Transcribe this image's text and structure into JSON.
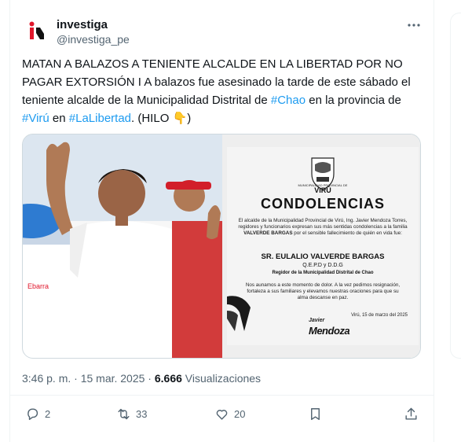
{
  "tweet": {
    "author_name": "investiga",
    "author_handle": "@investiga_pe",
    "text_parts": [
      {
        "t": "MATAN A BALAZOS A TENIENTE ALCALDE EN LA LIBERTAD POR NO PAGAR EXTORSIÓN I A balazos fue asesinado la tarde de este sábado el teniente alcalde de la Municipalidad Distrital de ",
        "tag": false
      },
      {
        "t": "#Chao",
        "tag": true
      },
      {
        "t": " en la provincia de ",
        "tag": false
      },
      {
        "t": "#Virú",
        "tag": true
      },
      {
        "t": " en ",
        "tag": false
      },
      {
        "t": "#LaLibertad",
        "tag": true
      },
      {
        "t": ". (HILO 👇)",
        "tag": false
      }
    ],
    "timestamp": "3:46 p. m. · 15 mar. 2025 · ",
    "views_count": "6.666",
    "views_label": " Visualizaciones",
    "replies": "2",
    "reposts": "33",
    "likes": "20"
  },
  "card": {
    "logo_line1": "MUNICIPALIDAD PROVINCIAL DE",
    "logo_line2": "VIRÚ",
    "title": "CONDOLENCIAS",
    "text1_a": "El alcalde de la Municipalidad Provincial de Virú, Ing. Javier Mendoza Torres, regidores y funcionarios expresan sus más sentidas condolencias a la familia ",
    "text1_b": "VALVERDE BARGAS",
    "text1_c": " por el sensible fallecimiento de quién en vida fue:",
    "name": "SR. EULALIO VALVERDE BARGAS",
    "qepd": "Q.E.P.D y D.D.G",
    "role": "Regidor de la Municipalidad Distrital de Chao",
    "text2": "Nos aunamos a este momento de dolor. A la vez pedimos resignación, fortaleza a sus familiares y elevamos nuestras oraciones para que su alma descanse en paz.",
    "date": "Virú, 15 de marzo del 2025",
    "sign1": "Javier",
    "sign2": "Mendoza"
  },
  "colors": {
    "accent": "#1d9bf0",
    "muted": "#536471",
    "text": "#0f1419",
    "brand_red": "#e0162b"
  }
}
